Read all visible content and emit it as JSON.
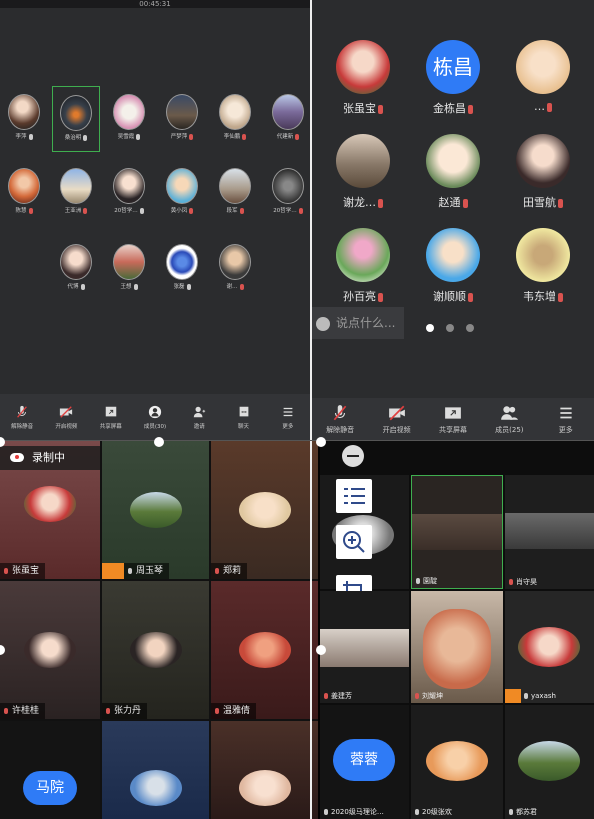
{
  "q1": {
    "timer": "00:45:31",
    "participants": [
      {
        "name": "李萍",
        "mic": "on"
      },
      {
        "name": "桑治明",
        "mic": "on"
      },
      {
        "name": "吴雪霞",
        "mic": "on"
      },
      {
        "name": "严梦萍",
        "mic": "off"
      },
      {
        "name": "李仙鹏",
        "mic": "off"
      },
      {
        "name": "代建新",
        "mic": "off"
      },
      {
        "name": "陈慧",
        "mic": "off"
      },
      {
        "name": "王亚洲",
        "mic": "off"
      },
      {
        "name": "20哲学…",
        "mic": "on"
      },
      {
        "name": "黄小凤",
        "mic": "off"
      },
      {
        "name": "段军",
        "mic": "off"
      },
      {
        "name": "20哲学…",
        "mic": "off"
      },
      {
        "name": "代博",
        "mic": "on"
      },
      {
        "name": "王想",
        "mic": "on"
      },
      {
        "name": "张磊",
        "mic": "on"
      },
      {
        "name": "谢…",
        "mic": "off"
      }
    ],
    "toolbar": [
      "解除静音",
      "开启视频",
      "共享屏幕",
      "成员(30)",
      "邀请",
      "聊天",
      "更多"
    ]
  },
  "q2": {
    "participants": [
      {
        "name": "张虽宝",
        "mic": "off"
      },
      {
        "name": "金栋昌",
        "mic": "off",
        "avatar_text": "栋昌"
      },
      {
        "name": "…",
        "mic": "off"
      },
      {
        "name": "谢龙…",
        "mic": "off"
      },
      {
        "name": "赵通",
        "mic": "off"
      },
      {
        "name": "田雪航",
        "mic": "off"
      },
      {
        "name": "孙百亮",
        "mic": "off"
      },
      {
        "name": "谢顺顺",
        "mic": "off"
      },
      {
        "name": "韦东增",
        "mic": "off"
      }
    ],
    "chat_placeholder": "说点什么...",
    "toolbar": [
      "解除静音",
      "开启视频",
      "共享屏幕",
      "成员(25)",
      "更多"
    ]
  },
  "q3": {
    "recording": "录制中",
    "tiles": [
      {
        "name": "张虽宝"
      },
      {
        "name": "周玉琴"
      },
      {
        "name": "郑莉"
      },
      {
        "name": "许桂桂"
      },
      {
        "name": "张力丹"
      },
      {
        "name": "温雅倩"
      },
      {
        "name": "",
        "avatar_text": "马院"
      },
      {
        "name": ""
      },
      {
        "name": ""
      }
    ]
  },
  "q4": {
    "tiles": [
      {
        "name": ""
      },
      {
        "name": "園靛"
      },
      {
        "name": "肖守昊"
      },
      {
        "name": "姜建芳"
      },
      {
        "name": "刘耀坤"
      },
      {
        "name": "yaxash"
      },
      {
        "name": "2020级马理论…",
        "avatar_text": "蓉蓉"
      },
      {
        "name": "20级张欢"
      },
      {
        "name": "都苏君"
      }
    ]
  },
  "colors": {
    "accent_blue": "#2f7bf6",
    "mic_off": "#d9534f",
    "active_speaker": "#3fae4f",
    "host_badge": "#f08a24"
  }
}
